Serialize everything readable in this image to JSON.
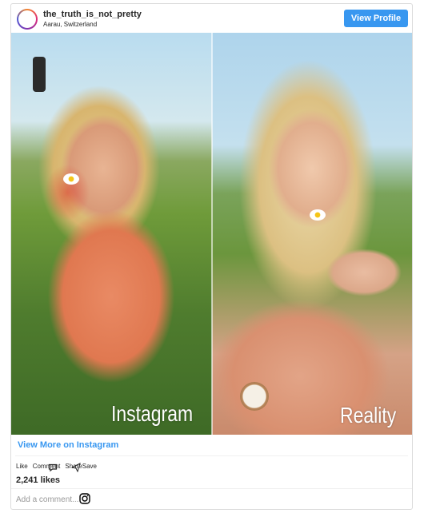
{
  "header": {
    "username": "the_truth_is_not_pretty",
    "location": "Aarau, Switzerland",
    "view_profile_label": "View Profile"
  },
  "photo": {
    "left_caption": "Instagram",
    "right_caption": "Reality"
  },
  "footer": {
    "view_more_label": "View More on Instagram",
    "like_label": "Like",
    "comment_label": "Comment",
    "share_label": "Share",
    "save_label": "Save",
    "likes_count": "2,241 likes",
    "add_comment_placeholder": "Add a comment..."
  },
  "icons": {
    "avatar": "avatar",
    "comment": "comment-icon",
    "share": "share-icon",
    "instagram": "instagram-icon"
  },
  "colors": {
    "accent": "#3897f0",
    "text": "#262626",
    "muted": "#999999",
    "border": "#dbdbdb"
  }
}
